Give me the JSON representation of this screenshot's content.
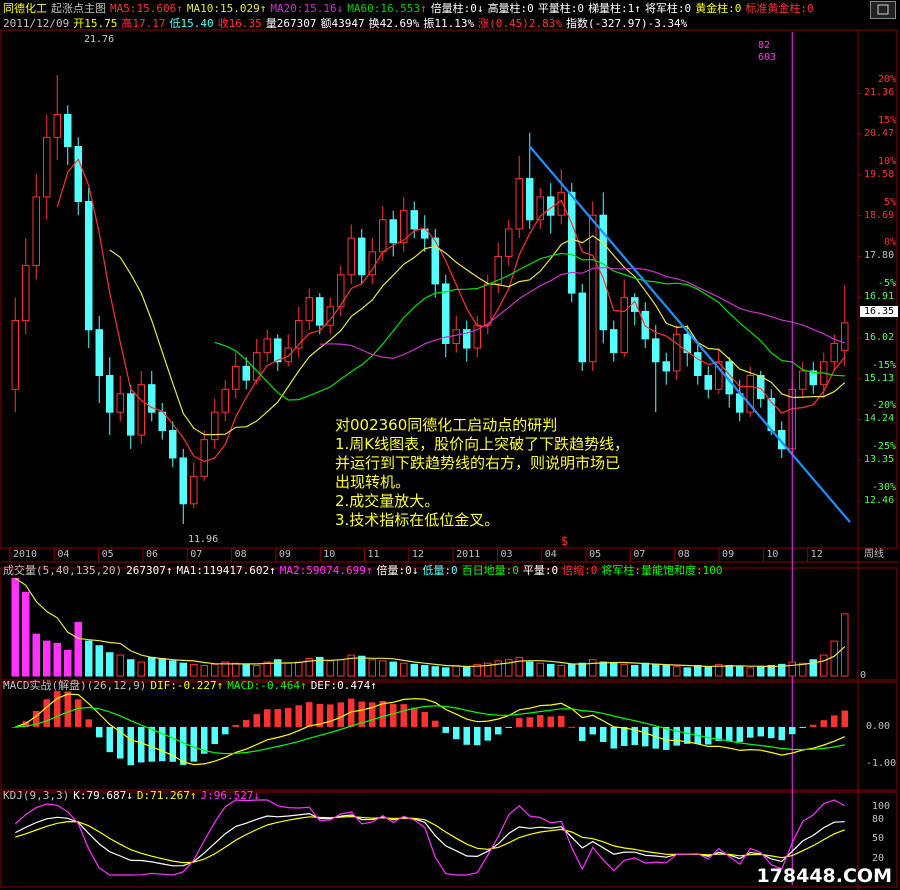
{
  "colors": {
    "up": "#ff3232",
    "down": "#54ffff",
    "ma5": "#ff3232",
    "ma10": "#e6e64c",
    "ma20": "#00e000",
    "ma60": "#cc33cc",
    "trend": "#1e90ff",
    "frame": "#8a0000",
    "annotation": "#ffff33",
    "yellow": "#ffff00",
    "magenta": "#ff33ff",
    "green": "#00ff00",
    "white": "#ffffff"
  },
  "header1": [
    {
      "text": "同德化工",
      "color": "#ffff00"
    },
    {
      "text": "起涨点主图",
      "color": "#c0c0c0"
    },
    {
      "text": "MA5:15.606↑",
      "color": "#ff3232"
    },
    {
      "text": "MA10:15.029↑",
      "color": "#e6e64c"
    },
    {
      "text": "MA20:15.16↓",
      "color": "#cc33cc"
    },
    {
      "text": "MA60:16.553↑",
      "color": "#00cc00"
    },
    {
      "text": "倍量柱:0↓",
      "color": "#ffffff"
    },
    {
      "text": "高量柱:0",
      "color": "#ffffff"
    },
    {
      "text": "平量柱:0",
      "color": "#ffffff"
    },
    {
      "text": "梯量柱:1↑",
      "color": "#ffffff"
    },
    {
      "text": "将军柱:0",
      "color": "#ffffff"
    },
    {
      "text": "黄金柱:0",
      "color": "#ffff00"
    },
    {
      "text": "标准黄金柱:0",
      "color": "#ff3232"
    }
  ],
  "header2": [
    {
      "text": "2011/12/09",
      "color": "#c0c0c0"
    },
    {
      "text": "开15.75",
      "color": "#ffff00"
    },
    {
      "text": "高17.17",
      "color": "#ff3232"
    },
    {
      "text": "低15.40",
      "color": "#54ffff"
    },
    {
      "text": "收16.35",
      "color": "#ff3232"
    },
    {
      "text": "量267307",
      "color": "#ffffff"
    },
    {
      "text": "额43947",
      "color": "#ffffff"
    },
    {
      "text": "换42.69%",
      "color": "#ffffff"
    },
    {
      "text": "振11.13%",
      "color": "#ffffff"
    },
    {
      "text": "涨(0.45)2.83%",
      "color": "#ff3232"
    },
    {
      "text": "指数(-327.97)-3.34%",
      "color": "#ffffff"
    }
  ],
  "price_axis": [
    {
      "pct": "20%",
      "price": "21.36"
    },
    {
      "pct": "15%",
      "price": "20.47"
    },
    {
      "pct": "10%",
      "price": "19.58"
    },
    {
      "pct": "5%",
      "price": "18.69"
    },
    {
      "pct": "0%",
      "price": "17.80"
    },
    {
      "pct": "-5%",
      "price": "16.91"
    },
    {
      "pct": "",
      "price": "16.02"
    },
    {
      "pct": "-15%",
      "price": "15.13"
    },
    {
      "pct": "-20%",
      "price": "14.24"
    },
    {
      "pct": "-25%",
      "price": "13.35"
    },
    {
      "pct": "-30%",
      "price": "12.46"
    }
  ],
  "current_price": "16.35",
  "high_mark": "21.76",
  "low_mark": "11.96",
  "cursor_label": [
    "82",
    "603"
  ],
  "month_axis": [
    "2010",
    "04",
    "05",
    "06",
    "07",
    "08",
    "09",
    "10",
    "11",
    "12",
    "2011",
    "03",
    "04",
    "05",
    "07",
    "08",
    "09",
    "10",
    "12"
  ],
  "period_label": "周线",
  "s_marker": "$",
  "volume_header": [
    {
      "text": "成交量(5,40,135,20)",
      "color": "#c0c0c0"
    },
    {
      "text": "267307↑",
      "color": "#ffffff"
    },
    {
      "text": "MA1:119417.602↑",
      "color": "#ffffff"
    },
    {
      "text": "MA2:59074.699↑",
      "color": "#ff33ff"
    },
    {
      "text": "倍量:0↓",
      "color": "#ffffff"
    },
    {
      "text": "低量:0",
      "color": "#54ffff"
    },
    {
      "text": "百日地量:0",
      "color": "#00ff00"
    },
    {
      "text": "平量:0",
      "color": "#ffffff"
    },
    {
      "text": "倍缩:0",
      "color": "#ff3232"
    },
    {
      "text": "将军柱:量能饱和度:100",
      "color": "#00ff00"
    }
  ],
  "volume_axis": [
    "400000",
    "200000",
    "0"
  ],
  "macd_header": [
    {
      "text": "MACD实战(解盘)(26,12,9)",
      "color": "#c0c0c0"
    },
    {
      "text": "DIF:-0.227↑",
      "color": "#ffff00"
    },
    {
      "text": "MACD:-0.464↑",
      "color": "#00ff00"
    },
    {
      "text": "DEF:0.474↑",
      "color": "#ffffff"
    }
  ],
  "macd_axis": [
    "0.00",
    "-1.00"
  ],
  "kdj_header": [
    {
      "text": "KDJ(9,3,3)",
      "color": "#c0c0c0"
    },
    {
      "text": "K:79.687↓",
      "color": "#ffffff"
    },
    {
      "text": "D:71.267↑",
      "color": "#ffff00"
    },
    {
      "text": "J:96.527↓",
      "color": "#ff33ff"
    }
  ],
  "kdj_axis": [
    "100",
    "80",
    "50",
    "20"
  ],
  "annotation": [
    "对002360同德化工启动点的研判",
    "1.周K线图表，股价向上突破了下跌趋势线，",
    "并运行到下跌趋势线的右方，则说明市场已",
    "出现转机。",
    "2.成交量放大。",
    "3.技术指标在低位金叉。"
  ],
  "watermark": "178448.COM",
  "chart_data": {
    "type": "candlestick",
    "period": "weekly",
    "yrange": [
      11.5,
      22.7
    ],
    "candles": [
      [
        14.9,
        16.4,
        14.4,
        16.9
      ],
      [
        16.4,
        17.6,
        16.1,
        18.2
      ],
      [
        17.6,
        19.1,
        17.3,
        19.6
      ],
      [
        19.1,
        20.4,
        18.6,
        20.9
      ],
      [
        20.4,
        20.9,
        19.9,
        21.76
      ],
      [
        20.9,
        20.2,
        19.8,
        21.1
      ],
      [
        20.2,
        19.0,
        18.7,
        20.4
      ],
      [
        19.0,
        16.2,
        15.8,
        19.3
      ],
      [
        16.2,
        15.2,
        14.6,
        16.5
      ],
      [
        15.2,
        14.4,
        13.9,
        15.6
      ],
      [
        14.4,
        14.8,
        14.2,
        15.2
      ],
      [
        14.8,
        13.9,
        13.6,
        15.0
      ],
      [
        13.9,
        15.0,
        13.7,
        15.3
      ],
      [
        15.0,
        14.4,
        14.2,
        15.3
      ],
      [
        14.4,
        14.0,
        13.8,
        14.6
      ],
      [
        14.0,
        13.4,
        13.2,
        14.2
      ],
      [
        13.4,
        12.4,
        11.96,
        13.6
      ],
      [
        12.4,
        13.0,
        12.3,
        13.3
      ],
      [
        13.0,
        13.8,
        12.9,
        14.0
      ],
      [
        13.8,
        14.4,
        13.6,
        14.7
      ],
      [
        14.4,
        14.9,
        14.2,
        15.1
      ],
      [
        14.9,
        15.4,
        14.7,
        15.7
      ],
      [
        15.4,
        15.1,
        14.9,
        15.6
      ],
      [
        15.1,
        15.7,
        15.0,
        16.0
      ],
      [
        15.7,
        16.0,
        15.5,
        16.2
      ],
      [
        16.0,
        15.5,
        15.3,
        16.1
      ],
      [
        15.5,
        15.8,
        15.4,
        16.1
      ],
      [
        15.8,
        16.4,
        15.6,
        16.7
      ],
      [
        16.4,
        16.9,
        16.2,
        17.1
      ],
      [
        16.9,
        16.3,
        16.1,
        17.0
      ],
      [
        16.3,
        16.7,
        16.1,
        16.9
      ],
      [
        16.7,
        17.4,
        16.5,
        17.6
      ],
      [
        17.4,
        18.2,
        17.2,
        18.5
      ],
      [
        18.2,
        17.4,
        17.2,
        18.4
      ],
      [
        17.4,
        17.9,
        17.2,
        18.2
      ],
      [
        17.9,
        18.6,
        17.7,
        18.9
      ],
      [
        18.6,
        18.1,
        17.8,
        18.8
      ],
      [
        18.1,
        18.8,
        17.9,
        19.1
      ],
      [
        18.8,
        18.4,
        18.2,
        19.0
      ],
      [
        18.4,
        18.2,
        17.9,
        18.7
      ],
      [
        18.2,
        17.2,
        16.9,
        18.4
      ],
      [
        17.2,
        15.9,
        15.6,
        17.4
      ],
      [
        15.9,
        16.2,
        15.7,
        16.5
      ],
      [
        16.2,
        15.8,
        15.5,
        16.4
      ],
      [
        15.8,
        16.3,
        15.6,
        16.5
      ],
      [
        16.3,
        17.2,
        16.1,
        17.4
      ],
      [
        17.2,
        17.8,
        17.0,
        18.1
      ],
      [
        17.8,
        18.4,
        17.6,
        18.6
      ],
      [
        18.4,
        19.5,
        18.2,
        20.0
      ],
      [
        19.5,
        18.6,
        18.4,
        20.5
      ],
      [
        18.6,
        19.1,
        18.4,
        19.3
      ],
      [
        19.1,
        18.7,
        18.3,
        19.4
      ],
      [
        18.7,
        19.2,
        18.5,
        19.7
      ],
      [
        19.2,
        17.0,
        16.8,
        19.4
      ],
      [
        17.0,
        15.5,
        15.3,
        17.2
      ],
      [
        15.5,
        18.7,
        15.3,
        19.0
      ],
      [
        18.7,
        16.2,
        15.9,
        19.2
      ],
      [
        16.2,
        15.7,
        15.5,
        16.4
      ],
      [
        15.7,
        16.9,
        15.6,
        17.3
      ],
      [
        16.9,
        16.6,
        16.3,
        17.0
      ],
      [
        16.6,
        16.0,
        15.8,
        16.8
      ],
      [
        16.0,
        15.5,
        14.4,
        16.3
      ],
      [
        15.5,
        15.3,
        15.0,
        15.7
      ],
      [
        15.3,
        16.1,
        15.1,
        16.3
      ],
      [
        16.1,
        15.7,
        15.4,
        16.3
      ],
      [
        15.7,
        15.2,
        15.0,
        15.9
      ],
      [
        15.2,
        14.9,
        14.7,
        15.4
      ],
      [
        14.9,
        15.5,
        14.8,
        15.8
      ],
      [
        15.5,
        14.8,
        14.5,
        15.6
      ],
      [
        14.8,
        14.4,
        14.2,
        15.1
      ],
      [
        14.4,
        15.2,
        14.3,
        15.4
      ],
      [
        15.2,
        14.7,
        14.5,
        15.3
      ],
      [
        14.7,
        14.0,
        13.9,
        14.9
      ],
      [
        14.0,
        13.6,
        13.4,
        14.2
      ],
      [
        13.6,
        14.9,
        13.5,
        15.1
      ],
      [
        14.9,
        15.3,
        14.7,
        15.5
      ],
      [
        15.3,
        15.0,
        14.8,
        15.5
      ],
      [
        15.0,
        15.5,
        14.7,
        15.7
      ],
      [
        15.5,
        15.9,
        15.3,
        16.1
      ],
      [
        15.75,
        16.35,
        15.4,
        17.17
      ]
    ],
    "volume": [
      420,
      360,
      180,
      150,
      140,
      110,
      230,
      150,
      130,
      100,
      90,
      70,
      60,
      80,
      75,
      65,
      55,
      50,
      45,
      50,
      60,
      55,
      50,
      45,
      60,
      70,
      55,
      60,
      75,
      80,
      65,
      70,
      90,
      85,
      70,
      65,
      60,
      55,
      50,
      45,
      40,
      35,
      45,
      40,
      50,
      55,
      65,
      70,
      80,
      60,
      55,
      50,
      45,
      50,
      55,
      70,
      60,
      55,
      50,
      45,
      55,
      50,
      45,
      40,
      35,
      45,
      40,
      50,
      45,
      40,
      35,
      40,
      45,
      50,
      60,
      55,
      70,
      90,
      150,
      267
    ],
    "volume_up_color_indices": [
      0,
      1,
      2,
      3,
      4,
      5,
      6
    ]
  }
}
